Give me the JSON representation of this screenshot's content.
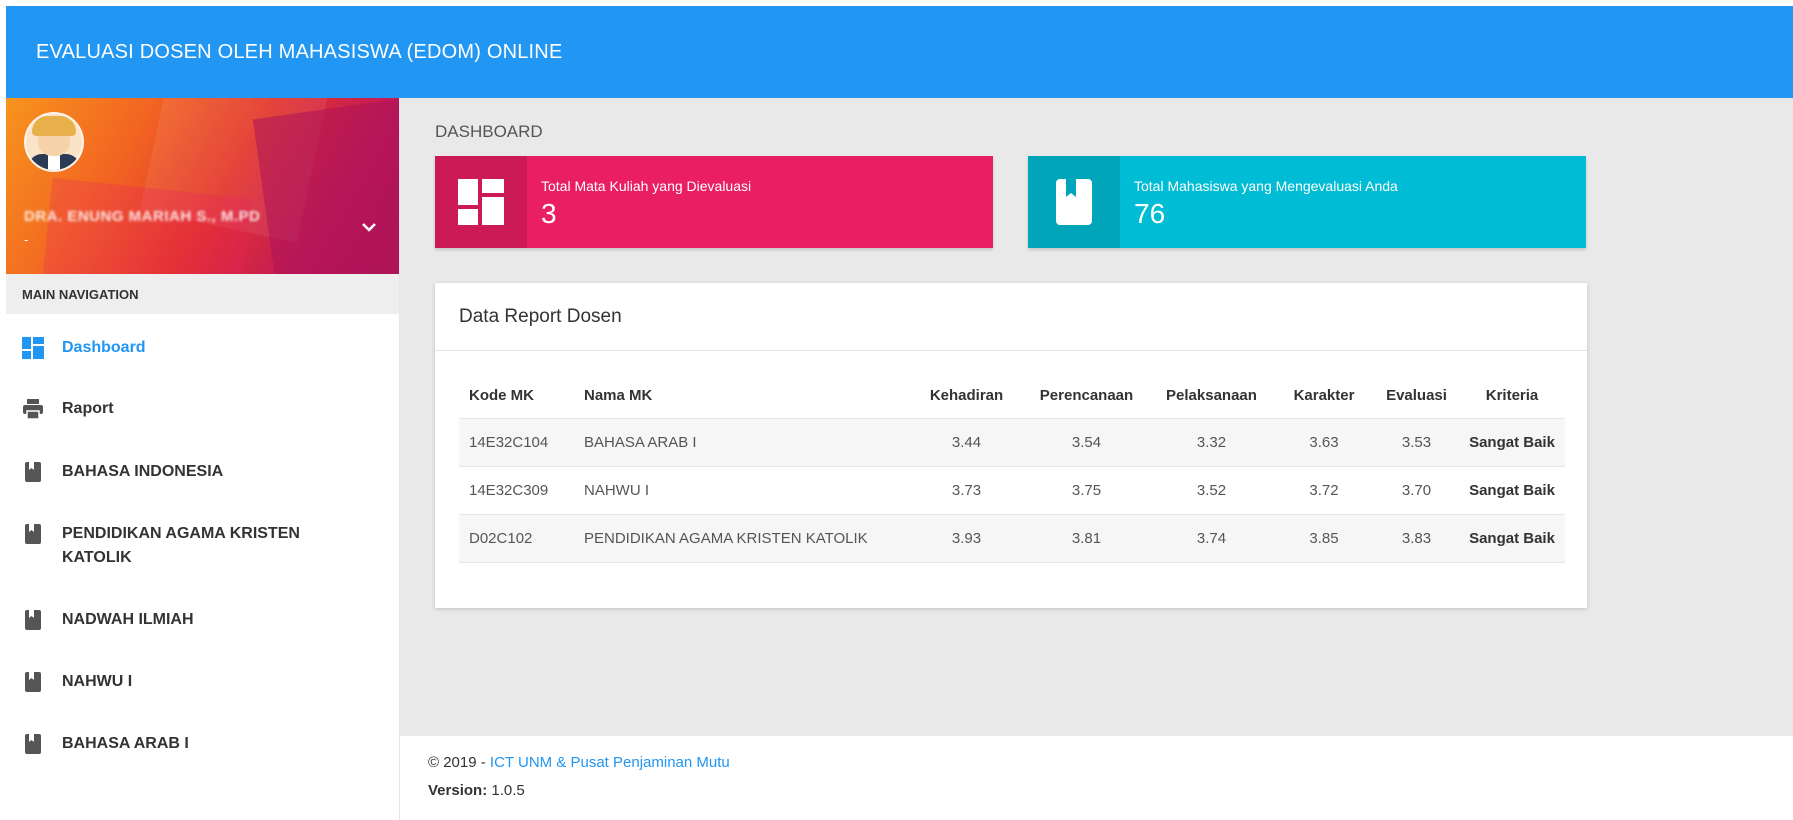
{
  "app": {
    "title": "EVALUASI DOSEN OLEH MAHASISWA (EDOM) ONLINE"
  },
  "user": {
    "name": "DRA. ENUNG MARIAH S., M.PD",
    "email": "-"
  },
  "sidebar": {
    "header": "MAIN NAVIGATION",
    "items": [
      {
        "label": "Dashboard",
        "icon": "dashboard-icon",
        "active": true
      },
      {
        "label": "Raport",
        "icon": "print-icon"
      },
      {
        "label": "BAHASA INDONESIA",
        "icon": "book-icon"
      },
      {
        "label": "PENDIDIKAN AGAMA KRISTEN KATOLIK",
        "icon": "book-icon"
      },
      {
        "label": "NADWAH ILMIAH",
        "icon": "book-icon"
      },
      {
        "label": "NAHWU I",
        "icon": "book-icon"
      },
      {
        "label": "BAHASA ARAB I",
        "icon": "book-icon"
      }
    ]
  },
  "page": {
    "title": "DASHBOARD"
  },
  "info_boxes": [
    {
      "label": "Total Mata Kuliah yang Dievaluasi",
      "value": "3",
      "color": "#e91e63",
      "icon": "dashboard-icon"
    },
    {
      "label": "Total Mahasiswa yang Mengevaluasi Anda",
      "value": "76",
      "color": "#00bcd4",
      "icon": "book-icon"
    }
  ],
  "report": {
    "title": "Data Report Dosen",
    "columns": [
      "Kode MK",
      "Nama MK",
      "Kehadiran",
      "Perencanaan",
      "Pelaksanaan",
      "Karakter",
      "Evaluasi",
      "Kriteria"
    ],
    "rows": [
      [
        "14E32C104",
        "BAHASA ARAB I",
        "3.44",
        "3.54",
        "3.32",
        "3.63",
        "3.53",
        "Sangat Baik"
      ],
      [
        "14E32C309",
        "NAHWU I",
        "3.73",
        "3.75",
        "3.52",
        "3.72",
        "3.70",
        "Sangat Baik"
      ],
      [
        "D02C102",
        "PENDIDIKAN AGAMA KRISTEN KATOLIK",
        "3.93",
        "3.81",
        "3.74",
        "3.85",
        "3.83",
        "Sangat Baik"
      ]
    ]
  },
  "footer": {
    "copyright_prefix": "© 2019 - ",
    "link_text": "ICT UNM & Pusat Penjaminan Mutu",
    "version_label": "Version:",
    "version_value": "1.0.5"
  },
  "colors": {
    "primary": "#2196f3",
    "pink": "#e91e63",
    "cyan": "#00bcd4"
  }
}
